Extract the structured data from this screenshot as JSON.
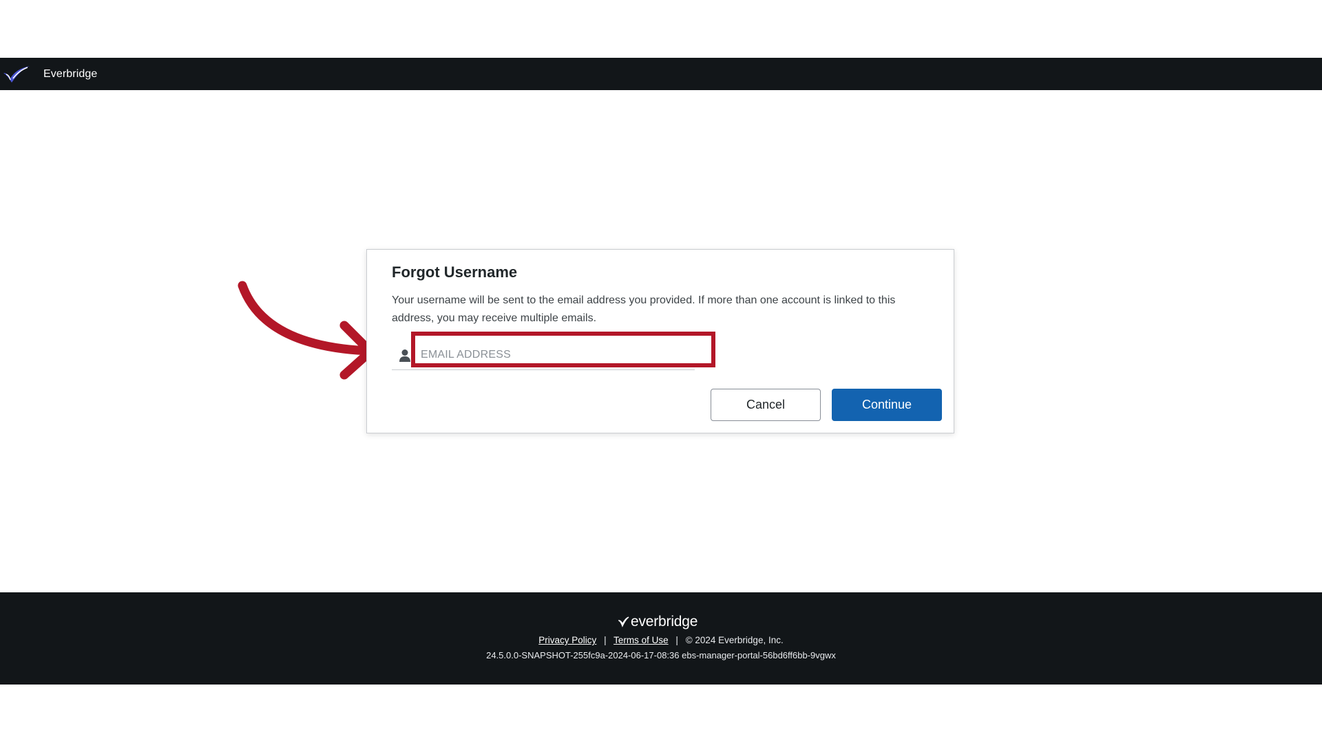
{
  "header": {
    "app_name": "Everbridge",
    "logo_icon": "everbridge-logo-icon"
  },
  "dialog": {
    "title": "Forgot Username",
    "description": "Your username will be sent to the email address you provided. If more than one account is linked to this address, you may receive multiple emails.",
    "email_field": {
      "placeholder": "EMAIL ADDRESS",
      "value": "",
      "icon": "person-icon"
    },
    "cancel_label": "Cancel",
    "continue_label": "Continue"
  },
  "footer": {
    "logo_text": "everbridge",
    "privacy_label": "Privacy Policy",
    "terms_label": "Terms of Use",
    "copyright": "© 2024 Everbridge, Inc.",
    "version": "24.5.0.0-SNAPSHOT-255fc9a-2024-06-17-08:36 ebs-manager-portal-56bd6ff6bb-9vgwx"
  },
  "colors": {
    "header_bg": "#121619",
    "primary": "#1363b0",
    "annotation": "#b31728"
  }
}
